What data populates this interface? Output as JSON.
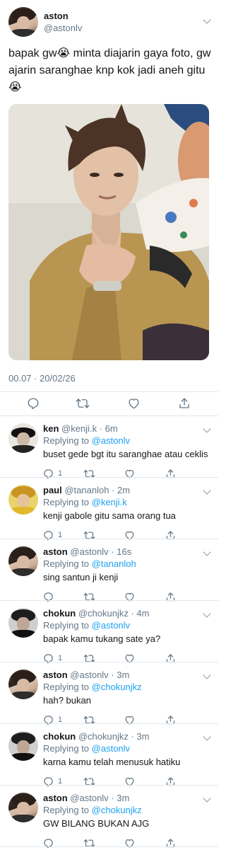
{
  "main_tweet": {
    "name": "aston",
    "handle": "@astonlv",
    "text": "bapak gw😭 minta diajarin gaya foto, gw ajarin saranghae knp kok jadi aneh gitu😭",
    "timestamp": "00.07 · 20/02/26",
    "actions": [
      "reply-icon",
      "retweet-icon",
      "like-icon",
      "share-icon"
    ]
  },
  "replies": [
    {
      "name": "ken",
      "handle": "@kenji.k · 6m",
      "replying_prefix": "Replying to ",
      "replying_to": "@astonlv",
      "text": "buset gede bgt itu saranghae atau ceklis",
      "reply_count": "1",
      "avatar": "ken"
    },
    {
      "name": "paul",
      "handle": "@tananloh · 2m",
      "replying_prefix": "Replying to ",
      "replying_to": "@kenji.k",
      "text": "kenji gabole gitu sama orang tua",
      "reply_count": "1",
      "avatar": "paul"
    },
    {
      "name": "aston",
      "handle": "@astonlv · 16s",
      "replying_prefix": "Replying to ",
      "replying_to": "@tananloh",
      "text": "sing santun ji kenji",
      "reply_count": "",
      "avatar": "aston"
    },
    {
      "name": "chokun",
      "handle": "@chokunjkz · 4m",
      "replying_prefix": "Replying to ",
      "replying_to": "@astonlv",
      "text": "bapak kamu tukang sate ya?",
      "reply_count": "1",
      "avatar": "chokun"
    },
    {
      "name": "aston",
      "handle": "@astonlv · 3m",
      "replying_prefix": "Replying to ",
      "replying_to": "@chokunjkz",
      "text": "hah? bukan",
      "reply_count": "1",
      "avatar": "aston"
    },
    {
      "name": "chokun",
      "handle": "@chokunjkz · 3m",
      "replying_prefix": "Replying to ",
      "replying_to": "@astonlv",
      "text": "karna kamu telah menusuk hatiku",
      "reply_count": "1",
      "avatar": "chokun"
    },
    {
      "name": "aston",
      "handle": "@astonlv · 3m",
      "replying_prefix": "Replying to ",
      "replying_to": "@chokunjkz",
      "text": "GW BILANG BUKAN AJG",
      "reply_count": "",
      "avatar": "aston"
    }
  ],
  "colors": {
    "link": "#1da1f2",
    "secondary_text": "#657786",
    "divider": "#e1e8ed",
    "icon": "#657786"
  }
}
